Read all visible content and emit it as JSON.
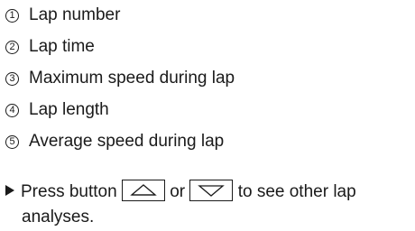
{
  "legend": {
    "items": [
      {
        "number": "1",
        "label": "Lap number"
      },
      {
        "number": "2",
        "label": "Lap time"
      },
      {
        "number": "3",
        "label": "Maximum speed during lap"
      },
      {
        "number": "4",
        "label": "Lap length"
      },
      {
        "number": "5",
        "label": "Average speed during lap"
      }
    ]
  },
  "instruction": {
    "prefix": "Press button",
    "up_button_icon": "up-arrow-icon",
    "connector": "or",
    "down_button_icon": "down-arrow-icon",
    "suffix_line1": "to see other lap",
    "suffix_line2": "analyses."
  }
}
